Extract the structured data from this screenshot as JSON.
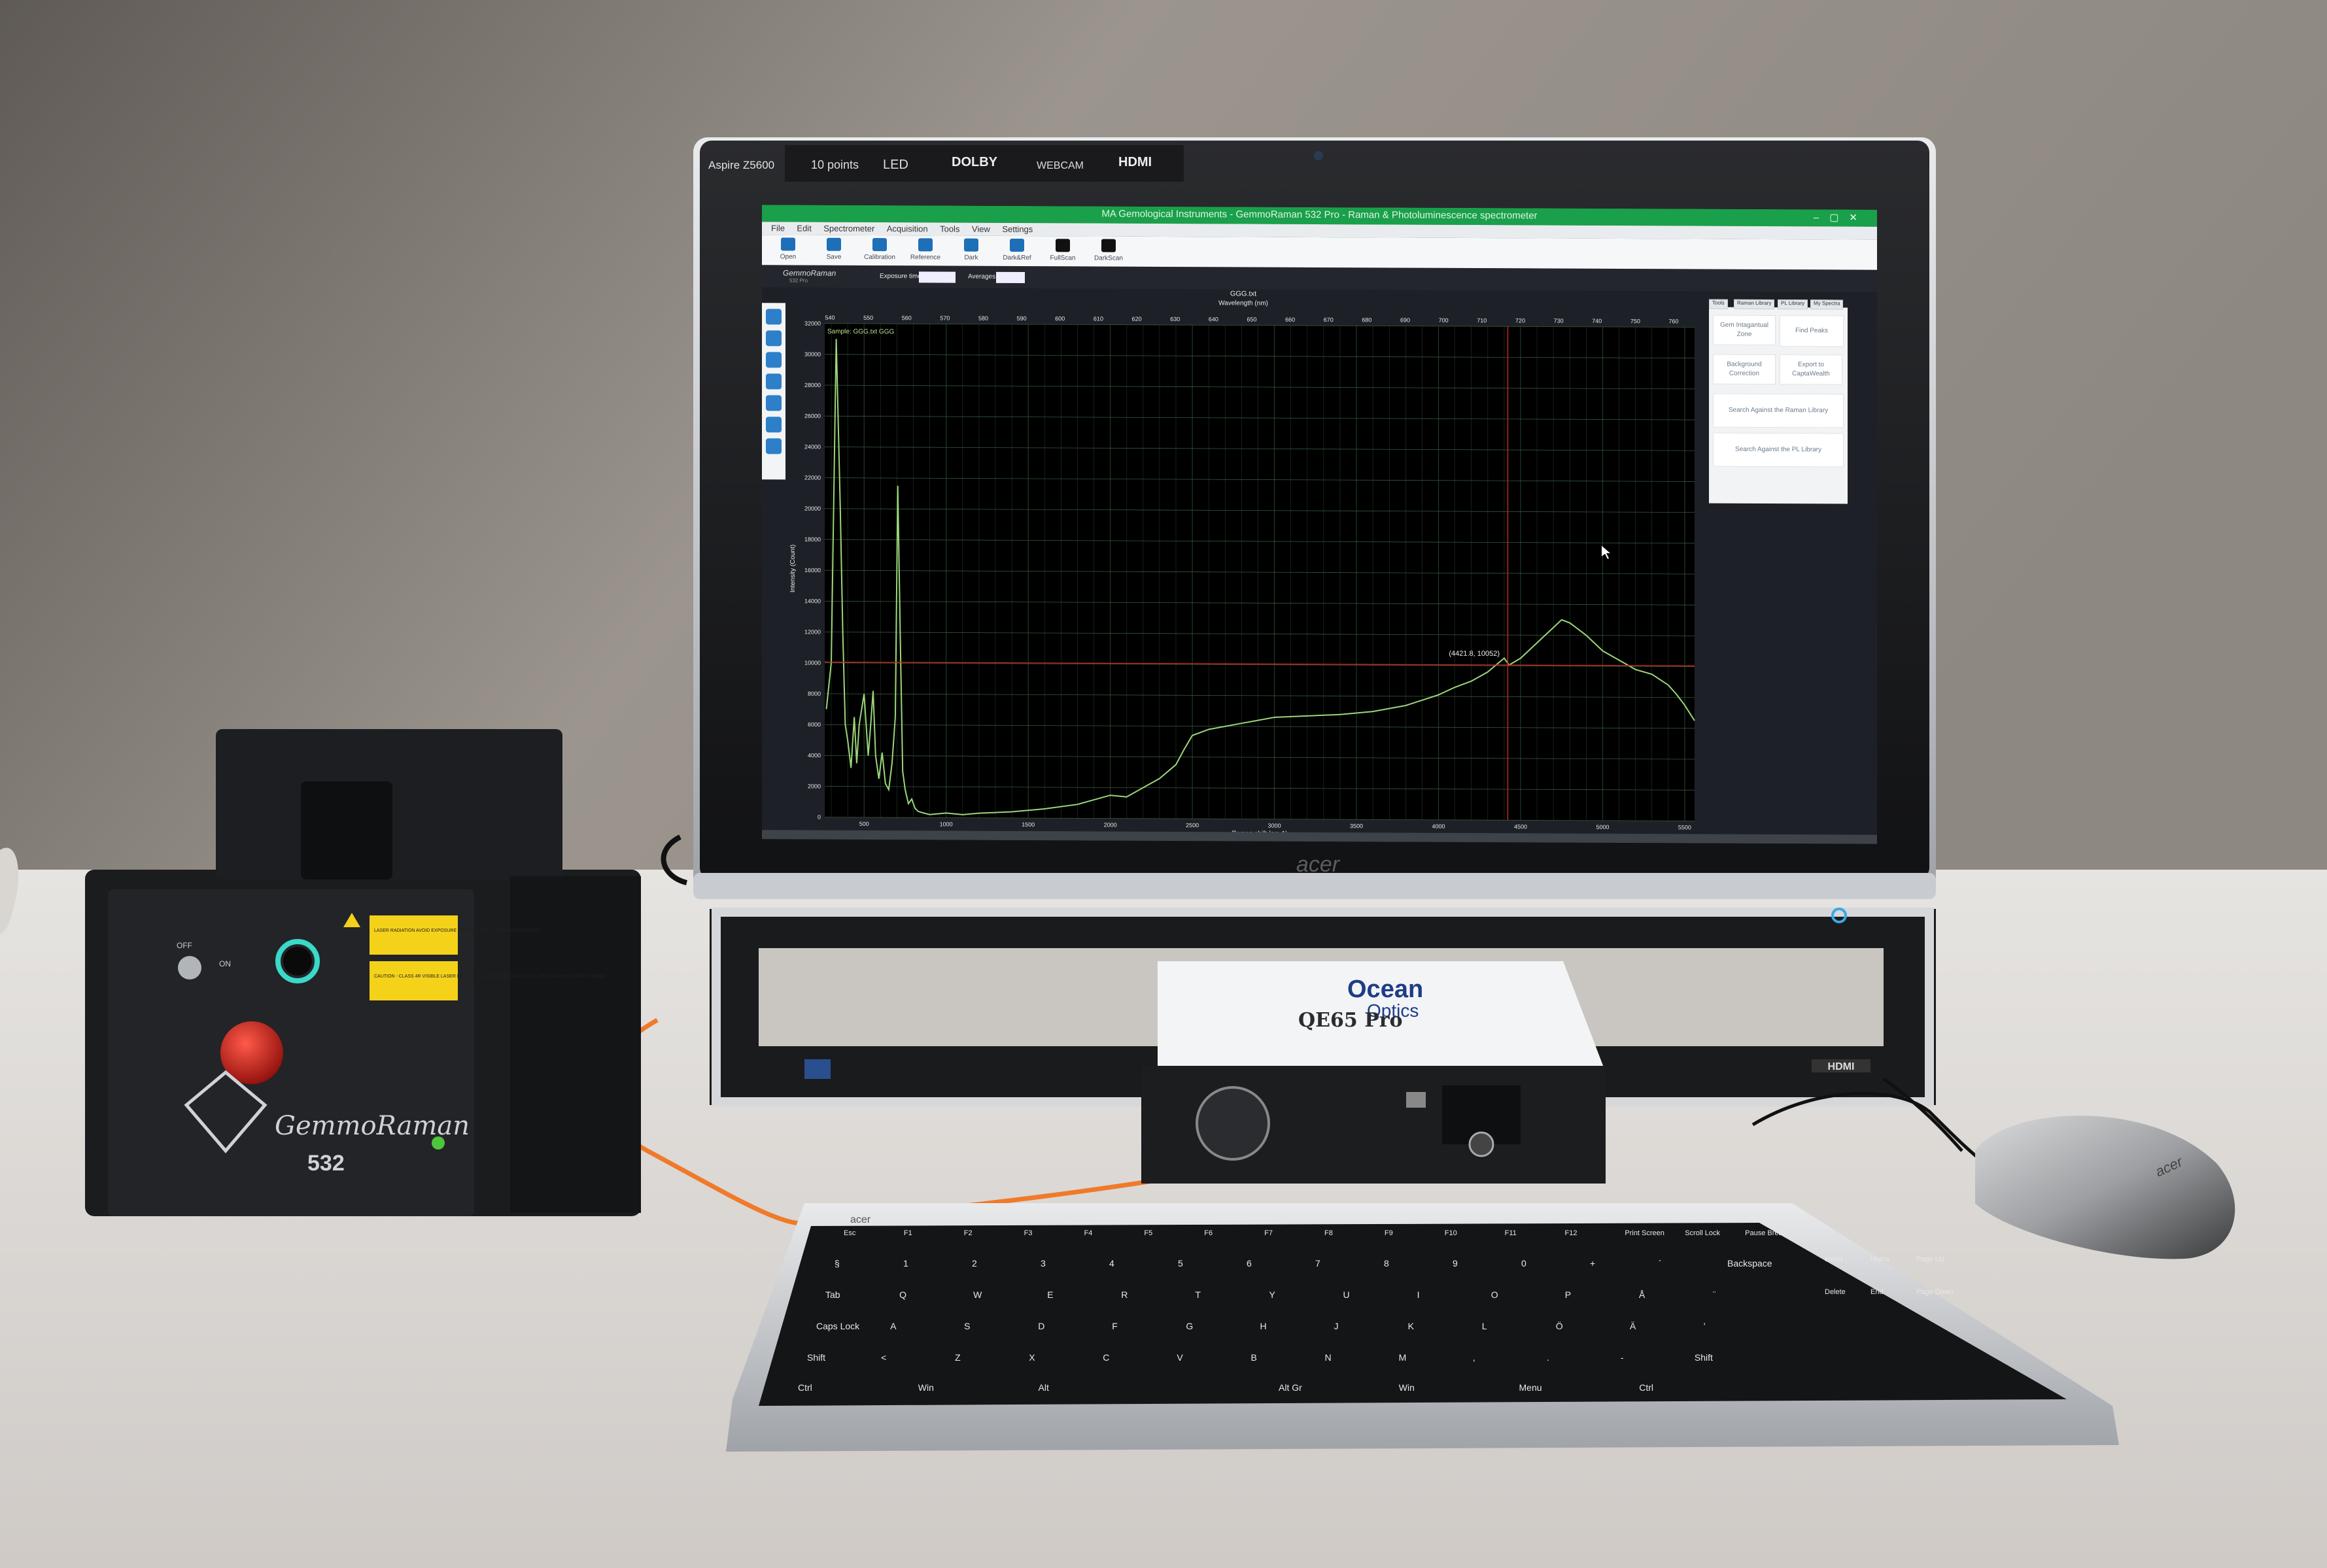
{
  "monitor": {
    "model_label": "Aspire Z5600",
    "badges": [
      "10 points",
      "LED",
      "DOLBY",
      "WEBCAM",
      "HDMI"
    ],
    "brand": "acer",
    "base_badge": "HDMI"
  },
  "app": {
    "window_title": "MA Gemological Instruments - GemmoRaman 532 Pro - Raman & Photoluminescence spectrometer",
    "menu": [
      "File",
      "Edit",
      "Spectrometer",
      "Acquisition",
      "Tools",
      "View",
      "Settings"
    ],
    "toolbar": [
      "Open",
      "Save",
      "Calibration",
      "Reference",
      "Dark",
      "Dark&Ref",
      "FullScan",
      "DarkScan"
    ],
    "logo_text": "GemmoRaman",
    "logo_sub": "532 Pro",
    "exposure_label": "Exposure time (ms):",
    "exposure_value": "",
    "averages_label": "Averages:",
    "averages_value": "",
    "right_tabs": [
      "Tools",
      "Raman Library",
      "PL Library",
      "My Spectra"
    ],
    "right_buttons": [
      "Gem Intagantual Zone",
      "Find Peaks",
      "Background Correction",
      "Export to CaptaWealth",
      "Search Against the Raman Library",
      "Search Against the PL Library"
    ],
    "colors": {
      "accent_green": "#1aa04a",
      "plot_bg": "#000000",
      "grid": "#35583a",
      "spectrum": "#9bd67a",
      "crosshair": "#c0281e"
    }
  },
  "chart_data": {
    "type": "line",
    "title": "GGG.txt",
    "top_axis_label": "Wavelength (nm)",
    "xlabel": "Raman shift (cm-1)",
    "ylabel": "Intensity (Count)",
    "legend": "Sample: GGG.txt GGG",
    "cursor_readout": "(4421.8, 10052)",
    "cursor": {
      "x": 4421.8,
      "y": 10052
    },
    "xlim": [
      260,
      5560
    ],
    "ylim": [
      0,
      32000
    ],
    "x_ticks": [
      500,
      1000,
      1500,
      2000,
      2500,
      3000,
      3500,
      4000,
      4500,
      5000,
      5500
    ],
    "y_ticks": [
      0,
      2000,
      4000,
      6000,
      8000,
      10000,
      12000,
      14000,
      16000,
      18000,
      20000,
      22000,
      24000,
      26000,
      28000,
      30000,
      32000
    ],
    "top_ticks": [
      540,
      550,
      560,
      570,
      580,
      590,
      600,
      610,
      620,
      630,
      640,
      650,
      660,
      670,
      680,
      690,
      700,
      710,
      720,
      730,
      740,
      750,
      760
    ],
    "grid": true,
    "series": [
      {
        "x": [
          270,
          300,
          330,
          355,
          370,
          385,
          400,
          420,
          440,
          455,
          470,
          500,
          525,
          540,
          555,
          570,
          590,
          610,
          630,
          650,
          670,
          690,
          705,
          720,
          735,
          750,
          770,
          790,
          810,
          830,
          860,
          900,
          1000,
          1100,
          1200,
          1400,
          1600,
          1800,
          1900,
          2000,
          2100,
          2200,
          2300,
          2400,
          2450,
          2500,
          2600,
          2800,
          3000,
          3200,
          3400,
          3600,
          3800,
          4000,
          4100,
          4200,
          4300,
          4400,
          4430,
          4500,
          4600,
          4700,
          4750,
          4800,
          4900,
          5000,
          5100,
          5200,
          5300,
          5400,
          5450,
          5500,
          5560
        ],
        "y": [
          7000,
          10000,
          31000,
          20000,
          12000,
          6000,
          5000,
          3200,
          6500,
          3500,
          6000,
          8000,
          4000,
          6000,
          8200,
          4000,
          2500,
          4200,
          2200,
          1800,
          3500,
          6500,
          21500,
          12000,
          3000,
          1800,
          900,
          1200,
          600,
          400,
          300,
          200,
          300,
          200,
          300,
          400,
          600,
          900,
          1200,
          1500,
          1400,
          2000,
          2600,
          3500,
          4500,
          5400,
          5800,
          6200,
          6600,
          6700,
          6800,
          7000,
          7400,
          8100,
          8600,
          9000,
          9600,
          10500,
          10052,
          10500,
          11500,
          12500,
          13000,
          12800,
          12000,
          11000,
          10400,
          9800,
          9500,
          8800,
          8200,
          7500,
          6500
        ]
      }
    ]
  },
  "laser": {
    "brand": "GemmoRaman",
    "model": "532",
    "key_off": "OFF",
    "key_on": "ON",
    "warning1": "LASER RADIATION AVOID EXPOSURE TO BEAM CLASS 3B LASER PRODUCT",
    "warning2": "CAUTION - CLASS 4R VISIBLE LASER RADIATION WHEN OPEN AVOID EYE OR SKIN EXPOSURE TO BEAM"
  },
  "spectrometer": {
    "brand_line1": "Ocean",
    "brand_line2": "Optics",
    "model": "QE65 Pro"
  },
  "keyboard": {
    "brand": "acer",
    "row_fn": [
      "Esc",
      "F1",
      "F2",
      "F3",
      "F4",
      "F5",
      "F6",
      "F7",
      "F8",
      "F9",
      "F10",
      "F11",
      "F12",
      "Print Screen",
      "Scroll Lock",
      "Pause Break"
    ],
    "row_num": [
      "§",
      "1",
      "2",
      "3",
      "4",
      "5",
      "6",
      "7",
      "8",
      "9",
      "0",
      "+",
      "´",
      "Backspace"
    ],
    "row_q": [
      "Tab",
      "Q",
      "W",
      "E",
      "R",
      "T",
      "Y",
      "U",
      "I",
      "O",
      "P",
      "Å",
      "¨"
    ],
    "row_a": [
      "Caps Lock",
      "A",
      "S",
      "D",
      "F",
      "G",
      "H",
      "J",
      "K",
      "L",
      "Ö",
      "Ä",
      "'"
    ],
    "row_z": [
      "Shift",
      "<",
      "Z",
      "X",
      "C",
      "V",
      "B",
      "N",
      "M",
      ",",
      ".",
      "-",
      "Shift"
    ],
    "row_space": [
      "Ctrl",
      "Win",
      "Alt",
      "",
      "Alt Gr",
      "Win",
      "Menu",
      "Ctrl"
    ],
    "nav": [
      "Insert",
      "Home",
      "Page Up",
      "Delete",
      "End",
      "Page Down"
    ]
  },
  "mouse": {
    "brand": "acer"
  }
}
